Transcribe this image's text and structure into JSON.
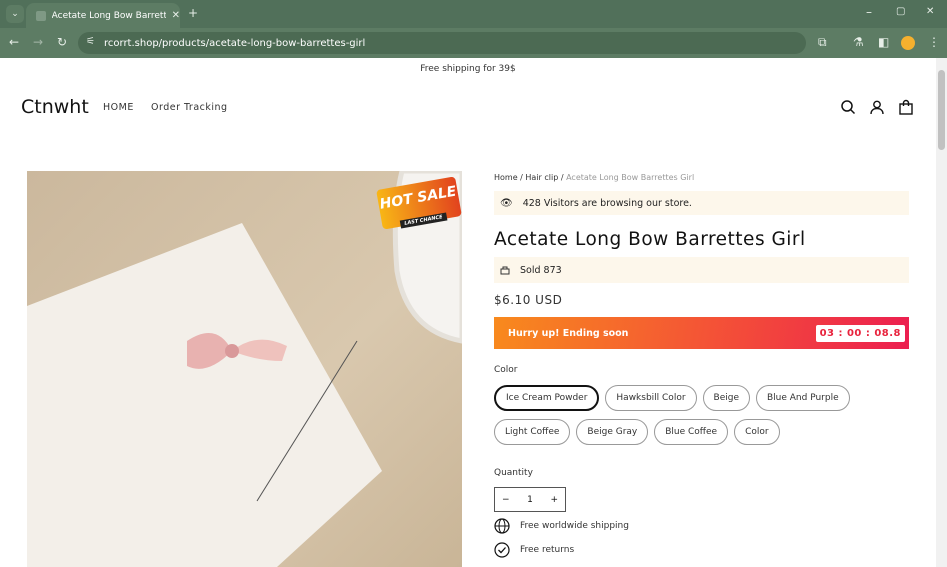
{
  "browser": {
    "tab_title": "Acetate Long Bow Barrettes Girl",
    "url": "rcorrt.shop/products/acetate-long-bow-barrettes-girl"
  },
  "announcement": "Free shipping for 39$",
  "header": {
    "logo": "Ctnwht",
    "nav": [
      "HOME",
      "Order Tracking"
    ]
  },
  "product": {
    "image_badge": {
      "main": "HOT SALE",
      "sub": "LAST CHANCE"
    },
    "breadcrumb": [
      "Home",
      "Hair clip",
      "Acetate Long Bow Barrettes Girl"
    ],
    "visitors": "428 Visitors are browsing our store.",
    "title": "Acetate Long Bow Barrettes Girl",
    "sold": "Sold 873",
    "price": "$6.10 USD",
    "hurry": {
      "text": "Hurry up! Ending soon",
      "countdown": "03 : 00 : 08.8"
    },
    "color_label": "Color",
    "colors": [
      "Ice Cream Powder",
      "Hawksbill Color",
      "Beige",
      "Blue And Purple",
      "Light Coffee",
      "Beige Gray",
      "Blue Coffee",
      "Color"
    ],
    "selected_color": "Ice Cream Powder",
    "quantity_label": "Quantity",
    "quantity": "1",
    "features": [
      "Free worldwide shipping",
      "Free returns"
    ]
  },
  "colors": {
    "chrome": "#51705a",
    "hurry_start": "#f88a1d",
    "hurry_end": "#ec1f50",
    "strip_bg": "#fdf7eb"
  }
}
